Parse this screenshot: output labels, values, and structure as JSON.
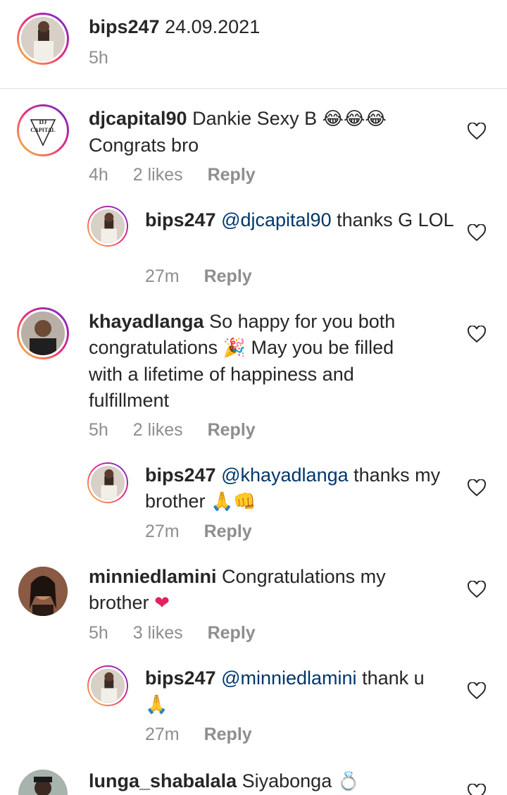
{
  "caption": {
    "username": "bips247",
    "text": "24.09.2021",
    "time": "5h"
  },
  "comments": [
    {
      "username": "djcapital90",
      "text_a": "Dankie Sexy B ",
      "emoji_a": "😂😂😂",
      "text_b": "Congrats bro",
      "time": "4h",
      "likes": "2 likes",
      "reply": "Reply",
      "avatar_text_top": "DJ",
      "avatar_text_bottom": "CAPITAL",
      "replies": [
        {
          "username": "bips247",
          "mention": "@djcapital90",
          "text": " thanks G LOL",
          "time": "27m",
          "reply": "Reply"
        }
      ]
    },
    {
      "username": "khayadlanga",
      "text_a": "So happy for you both congratulations ",
      "emoji_a": "🎉",
      "text_b": " May you be filled with a lifetime of happiness and fulfillment",
      "time": "5h",
      "likes": "2 likes",
      "reply": "Reply",
      "replies": [
        {
          "username": "bips247",
          "mention": "@khayadlanga",
          "text": " thanks my brother ",
          "emoji": "🙏👊",
          "time": "27m",
          "reply": "Reply"
        }
      ]
    },
    {
      "username": "minniedlamini",
      "text_a": "Congratulations my brother ",
      "emoji_a": "❤",
      "time": "5h",
      "likes": "3 likes",
      "reply": "Reply",
      "replies": [
        {
          "username": "bips247",
          "mention": "@minniedlamini",
          "text": " thank u ",
          "emoji": "🙏",
          "time": "27m",
          "reply": "Reply"
        }
      ]
    },
    {
      "username": "lunga_shabalala",
      "text_a": "Siyabonga ",
      "emoji_a": "💍"
    }
  ],
  "colors": {
    "mention": "#00376b",
    "meta": "#8e8e8e",
    "heart_red": "#e0245e"
  },
  "icons": {
    "like": "heart-outline-icon"
  }
}
